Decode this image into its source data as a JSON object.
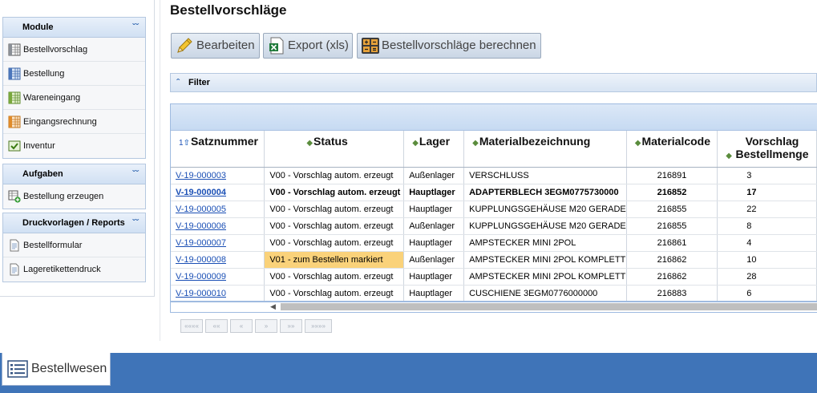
{
  "sidebar": {
    "sections": [
      {
        "title": "Module",
        "items": [
          {
            "label": "Bestellvorschlag"
          },
          {
            "label": "Bestellung"
          },
          {
            "label": "Wareneingang"
          },
          {
            "label": "Eingangsrechnung"
          },
          {
            "label": "Inventur"
          }
        ]
      },
      {
        "title": "Aufgaben",
        "items": [
          {
            "label": "Bestellung erzeugen"
          }
        ]
      },
      {
        "title": "Druckvorlagen / Reports",
        "items": [
          {
            "label": "Bestellformular"
          },
          {
            "label": "Lageretikettendruck"
          }
        ]
      }
    ]
  },
  "page": {
    "title": "Bestellvorschläge"
  },
  "toolbar": {
    "edit_label": "Bearbeiten",
    "export_label": "Export (xls)",
    "calc_label": "Bestellvorschläge berechnen"
  },
  "filter": {
    "label": "Filter"
  },
  "grid": {
    "sort_indicator": "1",
    "columns": [
      {
        "label": "Satznummer"
      },
      {
        "label": "Status"
      },
      {
        "label": "Lager"
      },
      {
        "label": "Materialbezeichnung"
      },
      {
        "label": "Materialcode"
      },
      {
        "label": "Vorschlag Bestellmenge"
      }
    ],
    "rows": [
      {
        "id": "V-19-000003",
        "status": "V00 - Vorschlag autom. erzeugt",
        "lager": "Außenlager",
        "material": "VERSCHLUSS",
        "code": "216891",
        "qty": "3"
      },
      {
        "id": "V-19-000004",
        "status": "V00 - Vorschlag autom. erzeugt",
        "lager": "Hauptlager",
        "material": "ADAPTERBLECH 3EGM0775730000",
        "code": "216852",
        "qty": "17"
      },
      {
        "id": "V-19-000005",
        "status": "V00 - Vorschlag autom. erzeugt",
        "lager": "Hauptlager",
        "material": "KUPPLUNGSGEHÄUSE M20 GERADE",
        "code": "216855",
        "qty": "22"
      },
      {
        "id": "V-19-000006",
        "status": "V00 - Vorschlag autom. erzeugt",
        "lager": "Außenlager",
        "material": "KUPPLUNGSGEHÄUSE M20 GERADE",
        "code": "216855",
        "qty": "8"
      },
      {
        "id": "V-19-000007",
        "status": "V00 - Vorschlag autom. erzeugt",
        "lager": "Hauptlager",
        "material": "AMPSTECKER MINI 2POL",
        "code": "216861",
        "qty": "4"
      },
      {
        "id": "V-19-000008",
        "status": "V01 - zum Bestellen markiert",
        "lager": "Außenlager",
        "material": "AMPSTECKER MINI 2POL KOMPLETT",
        "code": "216862",
        "qty": "10"
      },
      {
        "id": "V-19-000009",
        "status": "V00 - Vorschlag autom. erzeugt",
        "lager": "Hauptlager",
        "material": "AMPSTECKER MINI 2POL KOMPLETT",
        "code": "216862",
        "qty": "28"
      },
      {
        "id": "V-19-000010",
        "status": "V00 - Vorschlag autom. erzeugt",
        "lager": "Hauptlager",
        "material": "CUSCHIENE 3EGM0776000000",
        "code": "216883",
        "qty": "6"
      }
    ],
    "selected_row": 1,
    "highlight_row": 5
  },
  "pager": {
    "first": "««««",
    "prev_page": "««",
    "prev": "«",
    "next": "»",
    "next_page": "»»",
    "last": "»»»»"
  },
  "taskbar": {
    "tab_label": "Bestellwesen"
  },
  "colors": {
    "accent": "#3f74b8",
    "link": "#1a4fb5",
    "highlight": "#fad27a"
  }
}
